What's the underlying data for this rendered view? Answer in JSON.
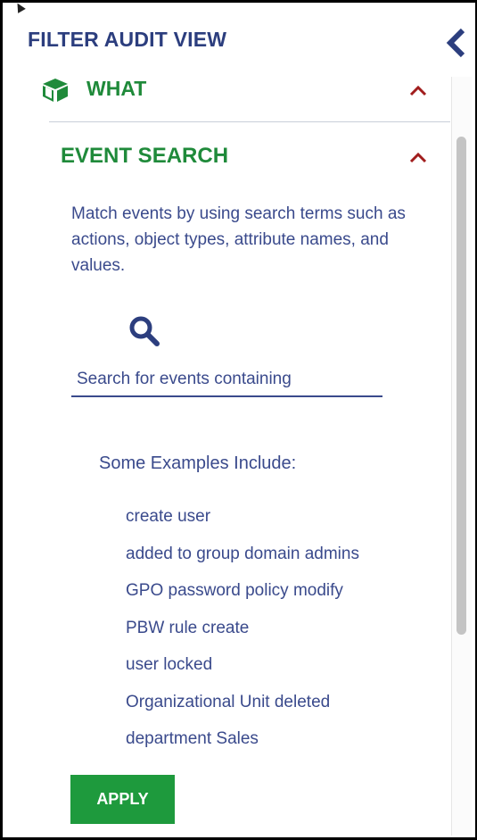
{
  "panel": {
    "title": "FILTER AUDIT VIEW"
  },
  "section_what": {
    "label": "WHAT",
    "icon": "cube-icon",
    "expanded": true
  },
  "event_search": {
    "title": "EVENT SEARCH",
    "expanded": true,
    "description": "Match events by using search terms such as actions, object types, attribute names, and values.",
    "search_placeholder": "Search for events containing",
    "search_value": "",
    "examples_heading": "Some Examples Include:",
    "examples": [
      "create user",
      "added to group domain admins",
      "GPO password policy modify",
      "PBW rule create",
      "user locked",
      "Organizational Unit deleted",
      "department Sales"
    ],
    "apply_label": "APPLY"
  },
  "colors": {
    "title_navy": "#2c3e7e",
    "section_green": "#1f8a3a",
    "chevron_red": "#a11d1d",
    "text_blue": "#3a4a8c",
    "button_green": "#1e9a3d"
  }
}
